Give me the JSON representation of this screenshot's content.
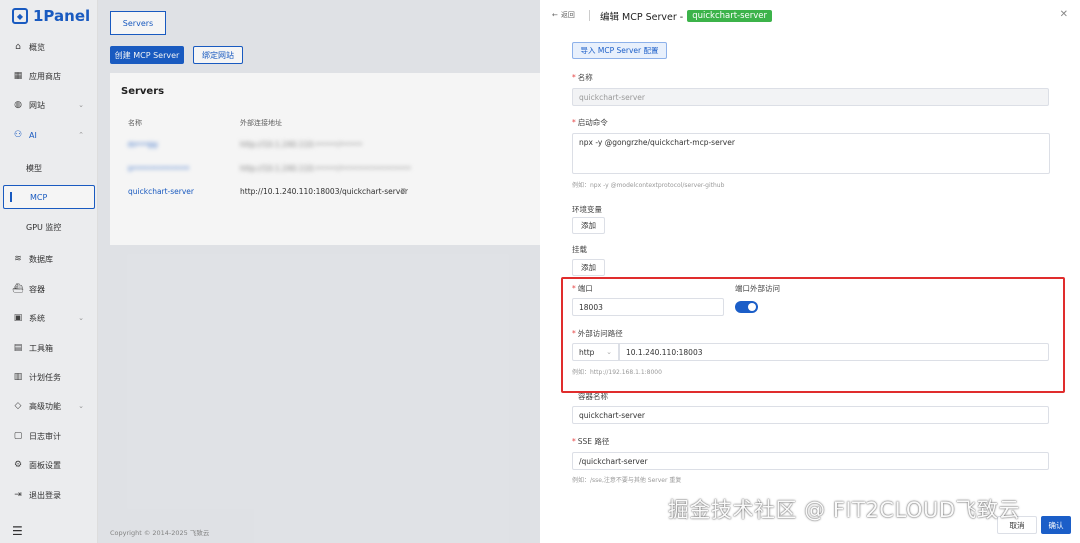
{
  "brand": {
    "name": "1Panel"
  },
  "sidebar": {
    "items": [
      {
        "label": "概览",
        "icon": "home-icon"
      },
      {
        "label": "应用商店",
        "icon": "grid-icon"
      },
      {
        "label": "网站",
        "icon": "globe-icon"
      },
      {
        "label": "AI",
        "icon": "ai-icon"
      },
      {
        "label": "模型",
        "icon": ""
      },
      {
        "label": "MCP",
        "icon": ""
      },
      {
        "label": "GPU 监控",
        "icon": ""
      },
      {
        "label": "数据库",
        "icon": "database-icon"
      },
      {
        "label": "容器",
        "icon": "container-icon"
      },
      {
        "label": "系统",
        "icon": "system-icon"
      },
      {
        "label": "工具箱",
        "icon": "toolbox-icon"
      },
      {
        "label": "计划任务",
        "icon": "calendar-icon"
      },
      {
        "label": "高级功能",
        "icon": "diamond-icon"
      },
      {
        "label": "日志审计",
        "icon": "log-icon"
      },
      {
        "label": "面板设置",
        "icon": "settings-icon"
      },
      {
        "label": "退出登录",
        "icon": "logout-icon"
      }
    ]
  },
  "main": {
    "tab": "Servers",
    "create_button": "创建 MCP Server",
    "bind_button": "绑定网站",
    "card_title": "Servers",
    "columns": [
      "名称",
      "外部连接地址"
    ],
    "rows": [
      {
        "name": "m•••py",
        "url": "http://10.1.240.110:•••••/•••••",
        "blurred": true
      },
      {
        "name": "s•••••••••••••",
        "url": "http://10.1.240.110:•••••/••••••••••••••••",
        "blurred": true
      },
      {
        "name": "quickchart-server",
        "url": "http://10.1.240.110:18003/quickchart-server",
        "blurred": false
      }
    ],
    "footer": "Copyright © 2014-2025 飞致云"
  },
  "drawer": {
    "back_label": "返回",
    "title": "编辑 MCP Server -",
    "title_tag": "quickchart-server",
    "import_button": "导入 MCP Server 配置",
    "name_label": "名称",
    "name_value": "quickchart-server",
    "command_label": "启动命令",
    "command_value": "npx -y @gongrzhe/quickchart-mcp-server",
    "command_hint": "例如：npx -y @modelcontextprotocol/server-github",
    "env_label": "环境变量",
    "add_label": "添加",
    "mount_label": "挂载",
    "port_label": "端口",
    "port_value": "18003",
    "external_access_label": "端口外部访问",
    "external_access_enabled": true,
    "path_label": "外部访问路径",
    "protocol": "http",
    "host_value": "10.1.240.110:18003",
    "path_hint": "例如：http://192.168.1.1:8000",
    "container_label": "容器名称",
    "container_value": "quickchart-server",
    "sse_label": "SSE 路径",
    "sse_value": "/quickchart-server",
    "sse_hint": "例如：/sse,注意不要与其他 Server 重复",
    "cancel_button": "取消",
    "confirm_button": "确认"
  },
  "watermark": "掘金技术社区 @ FIT2CLOUD飞致云",
  "colors": {
    "primary": "#1b5ec8",
    "tag_green": "#3cb34a",
    "highlight_red": "#e02d2d"
  }
}
